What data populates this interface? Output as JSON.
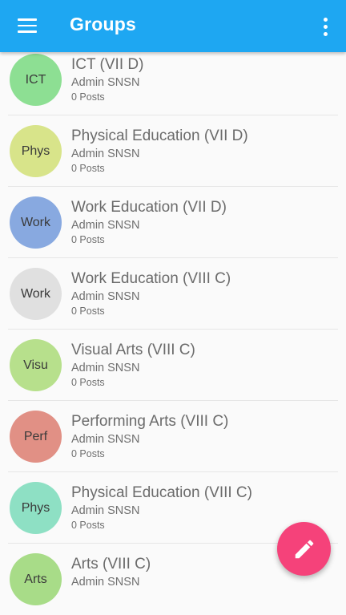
{
  "appbar": {
    "title": "Groups",
    "menu_icon": "hamburger-menu-icon",
    "more_icon": "more-vertical-icon",
    "color": "#1ea7f2"
  },
  "groups": [
    {
      "initials": "ICT",
      "name": "ICT (VII D)",
      "owner": "Admin SNSN",
      "posts": "0 Posts",
      "color": "#8ddf93"
    },
    {
      "initials": "Phys",
      "name": "Physical Education (VII D)",
      "owner": "Admin SNSN",
      "posts": "0 Posts",
      "color": "#d8e48a"
    },
    {
      "initials": "Work",
      "name": "Work Education (VII D)",
      "owner": "Admin SNSN",
      "posts": "0 Posts",
      "color": "#88a9e0"
    },
    {
      "initials": "Work",
      "name": "Work Education (VIII C)",
      "owner": "Admin SNSN",
      "posts": "0 Posts",
      "color": "#e0e0e0"
    },
    {
      "initials": "Visu",
      "name": "Visual Arts (VIII C)",
      "owner": "Admin SNSN",
      "posts": "0 Posts",
      "color": "#b7e08c"
    },
    {
      "initials": "Perf",
      "name": "Performing Arts (VIII C)",
      "owner": "Admin SNSN",
      "posts": "0 Posts",
      "color": "#e19085"
    },
    {
      "initials": "Phys",
      "name": "Physical Education (VIII C)",
      "owner": "Admin SNSN",
      "posts": "0 Posts",
      "color": "#8ee0c4"
    },
    {
      "initials": "Arts",
      "name": "Arts (VIII C)",
      "owner": "Admin SNSN",
      "posts": "",
      "color": "#a8dc88"
    }
  ],
  "fab": {
    "icon": "pencil-icon",
    "color": "#f5427a"
  }
}
